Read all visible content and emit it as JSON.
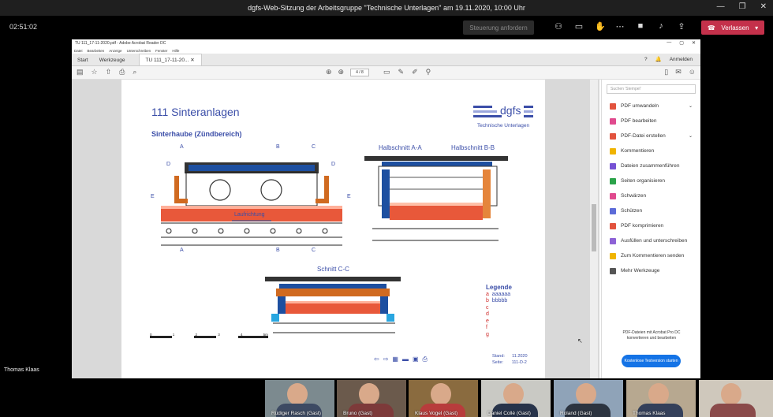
{
  "teams": {
    "window_title": "dgfs-Web-Sitzung der Arbeitsgruppe \"Technische Unterlagen\" am 19.11.2020, 10:00 Uhr",
    "timer": "02:51:02",
    "request_control_label": "Steuerung anfordern",
    "leave_label": "Verlassen",
    "presenter_name": "Thomas Klaas",
    "participants": [
      {
        "name": "Rüdiger Rasch (Gast)"
      },
      {
        "name": "Bruno (Gast)"
      },
      {
        "name": "Klaus Vogel (Gast)"
      },
      {
        "name": "Daniel Collé (Gast)"
      },
      {
        "name": "Roland (Gast)"
      },
      {
        "name": "Thomas Klaas"
      },
      {
        "name": ""
      }
    ]
  },
  "acrobat": {
    "title": "TU 111_17-11-2020.pdf - Adobe Acrobat Reader DC",
    "menu": [
      "Datei",
      "Bearbeiten",
      "Anzeige",
      "Unterschreiben",
      "Fenster",
      "Hilfe"
    ],
    "tabs": {
      "start": "Start",
      "tools": "Werkzeuge",
      "doc": "TU 111_17-11-20..."
    },
    "sign_in": "Anmelden",
    "page_indicator": "4 / 8",
    "search_placeholder": "Suchen 'Stempel'",
    "tools": [
      {
        "label": "PDF umwandeln",
        "color": "#e2533e",
        "chevron": true
      },
      {
        "label": "PDF bearbeiten",
        "color": "#e04a8e",
        "chevron": false
      },
      {
        "label": "PDF-Datei erstellen",
        "color": "#e2533e",
        "chevron": true
      },
      {
        "label": "Kommentieren",
        "color": "#f0b400",
        "chevron": false
      },
      {
        "label": "Dateien zusammenführen",
        "color": "#7652d4",
        "chevron": false
      },
      {
        "label": "Seiten organisieren",
        "color": "#2ba34a",
        "chevron": false
      },
      {
        "label": "Schwärzen",
        "color": "#e04a8e",
        "chevron": false
      },
      {
        "label": "Schützen",
        "color": "#5c6bd8",
        "chevron": false
      },
      {
        "label": "PDF komprimieren",
        "color": "#e2533e",
        "chevron": false
      },
      {
        "label": "Ausfüllen und unterschreiben",
        "color": "#8d62d6",
        "chevron": false
      },
      {
        "label": "Zum Kommentieren senden",
        "color": "#f0b400",
        "chevron": false
      },
      {
        "label": "Mehr Werkzeuge",
        "color": "#555555",
        "chevron": false
      }
    ],
    "promo_line1": "PDF-Dateien mit Acrobat Pro DC",
    "promo_line2": "konvertieren und bearbeiten",
    "promo_button": "Kostenlose Testversion starten"
  },
  "pdf_page": {
    "title": "111 Sinteranlagen",
    "subtitle": "Sinterhaube (Zündbereich)",
    "logo_text": "dgfs",
    "logo_caption": "Technische Unterlagen",
    "section_a": "Halbschnitt A-A",
    "section_b": "Halbschnitt B-B",
    "section_c": "Schnitt C-C",
    "laufrichtung": "Laufrichtung",
    "marks": {
      "a": "A",
      "b": "B",
      "c": "C",
      "d": "D",
      "e": "E"
    },
    "legend_title": "Legende",
    "legend": [
      {
        "key": "a",
        "text": "aaaaaa"
      },
      {
        "key": "b",
        "text": "bbbbb"
      },
      {
        "key": "c",
        "text": ""
      },
      {
        "key": "d",
        "text": ""
      },
      {
        "key": "e",
        "text": ""
      },
      {
        "key": "f",
        "text": ""
      },
      {
        "key": "g",
        "text": ""
      }
    ],
    "scale_labels": [
      "0",
      "1",
      "2",
      "3",
      "4",
      "5m"
    ],
    "stand_label": "Stand:",
    "stand_value": "11.2020",
    "seite_label": "Seite:",
    "seite_value": "111-D-2"
  }
}
